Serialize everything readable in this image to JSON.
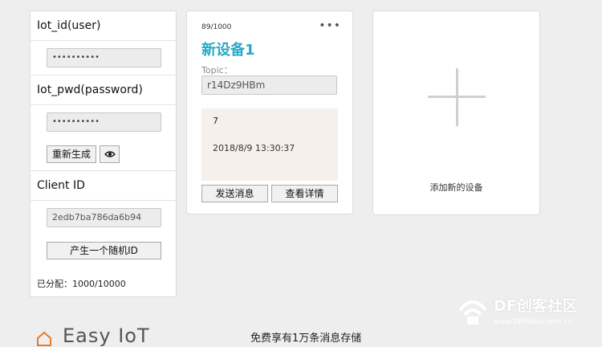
{
  "credentials": {
    "user_label": "Iot_id(user)",
    "user_value": "••••••••••",
    "pwd_label": "Iot_pwd(password)",
    "pwd_value": "••••••••••",
    "regenerate_label": "重新生成",
    "client_id_label": "Client ID",
    "client_id_value": "2edb7ba786da6b94",
    "random_id_label": "产生一个随机ID",
    "allocated_text": "已分配：1000/10000"
  },
  "device_card": {
    "count": "89/1000",
    "more": "•••",
    "name": "新设备1",
    "topic_label": "Topic：",
    "topic_value": "r14Dz9HBm",
    "message_value": "7",
    "message_time": "2018/8/9 13:30:37",
    "send_label": "发送消息",
    "details_label": "查看详情"
  },
  "add_card": {
    "label": "添加新的设备"
  },
  "footer": {
    "brand": "Easy IoT",
    "promo": "免费享有1万条消息存储"
  },
  "watermark": {
    "title": "DF创客社区",
    "url": "www.DFRobot.com.cn"
  },
  "colors": {
    "accent": "#29a8c6",
    "message_bg": "#f5f0ec"
  }
}
